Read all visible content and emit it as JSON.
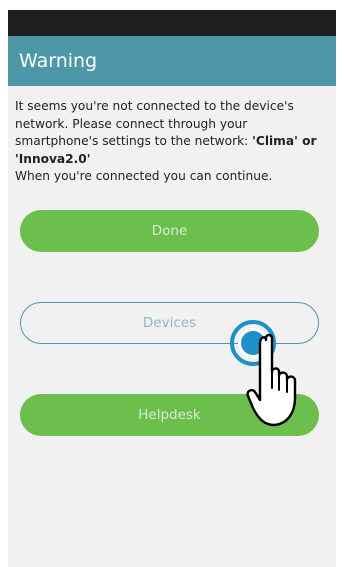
{
  "header": {
    "title": "Warning"
  },
  "message": {
    "line1": "It seems you're not connected to the device's network. Please connect through your smartphone's settings to the network: ",
    "networks": "'Clima' or 'Innova2.0'",
    "line2": "When you're connected you can continue."
  },
  "buttons": {
    "done": "Done",
    "devices": "Devices",
    "helpdesk": "Helpdesk"
  },
  "icons": {
    "tap": "tap-indicator-icon",
    "hand": "pointing-hand-icon"
  },
  "colors": {
    "header": "#4e97a8",
    "button_green": "#6cbf4c",
    "outline": "#4e97a8",
    "tap_blue": "#1f8fc7"
  }
}
